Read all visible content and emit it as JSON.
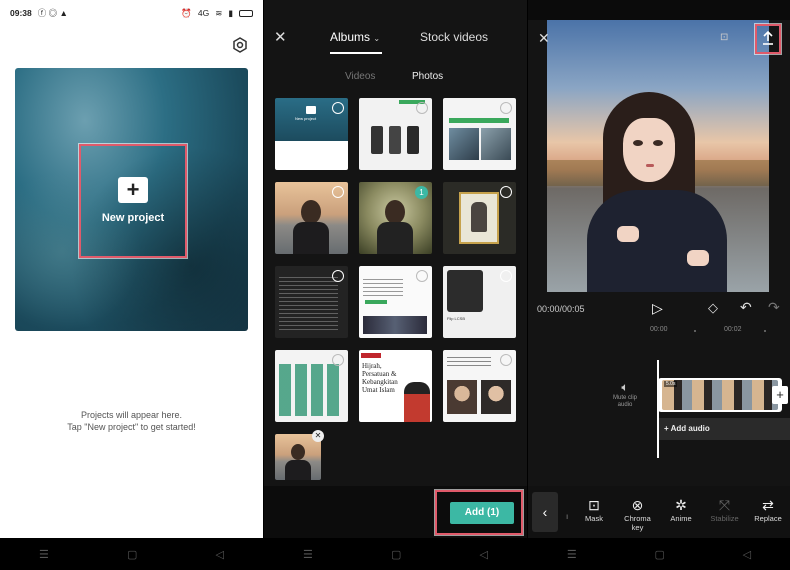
{
  "panel1": {
    "status": {
      "time": "09:38",
      "network": "4G"
    },
    "new_project_label": "New project",
    "empty_line1": "Projects will appear here.",
    "empty_line2": "Tap \"New project\" to get started!"
  },
  "panel2": {
    "tabs": {
      "albums": "Albums",
      "stock": "Stock videos"
    },
    "subtabs": {
      "videos": "Videos",
      "photos": "Photos"
    },
    "selected_count": "1",
    "thumb_text": {
      "t1": "New project",
      "t9": "Flip LCSB",
      "t10_a": "Hijrah,",
      "t10_b": "Persatuan &",
      "t10_c": "Kebangkitan",
      "t10_d": "Umat Islam"
    },
    "add_button": "Add (1)"
  },
  "panel3": {
    "time_readout": "00:00/00:05",
    "ruler": [
      "00:00",
      "00:02"
    ],
    "mute_label": "Mute clip audio",
    "add_audio": "+ Add audio",
    "clip_duration": "5.0s",
    "tools": [
      {
        "icon": "mask-icon",
        "label": "Mask"
      },
      {
        "icon": "chroma-key-icon",
        "label": "Chroma key"
      },
      {
        "icon": "anime-icon",
        "label": "Anime"
      },
      {
        "icon": "stabilize-icon",
        "label": "Stabilize"
      },
      {
        "icon": "replace-icon",
        "label": "Replace"
      }
    ]
  },
  "colors": {
    "accent_teal": "#3cb8a4",
    "highlight": "#e05a6a"
  }
}
